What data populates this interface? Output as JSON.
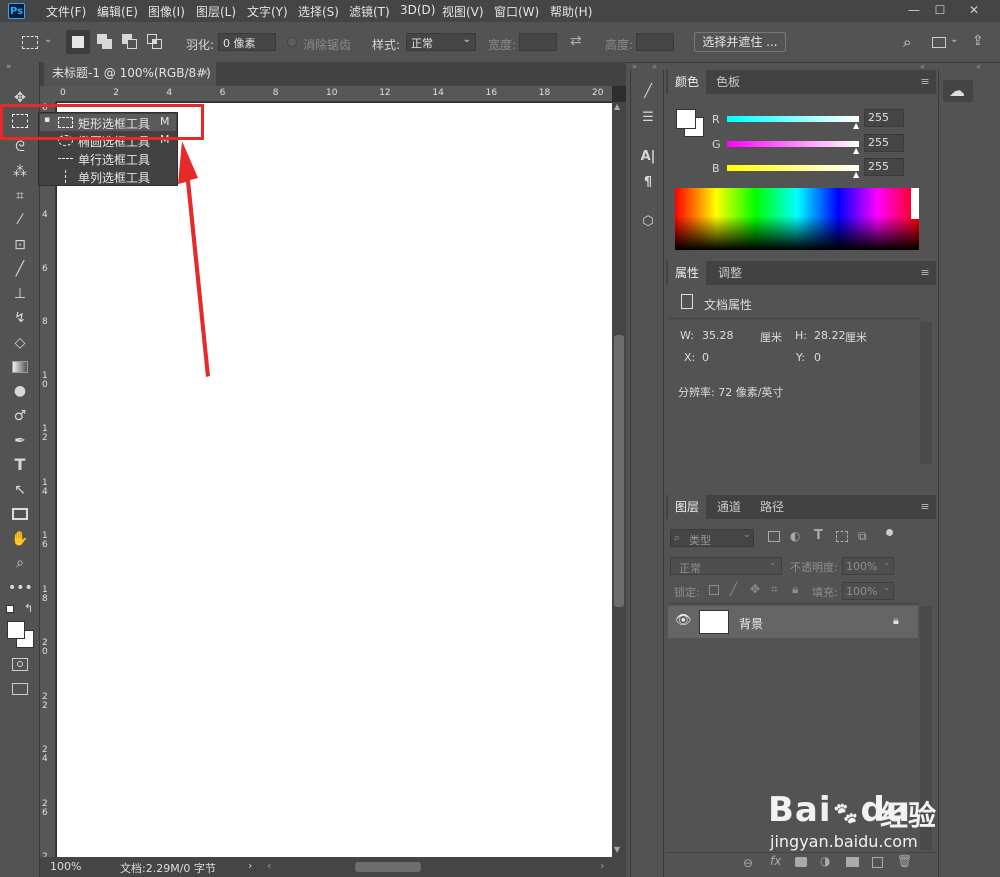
{
  "menubar": {
    "logo": "Ps",
    "items": [
      "文件(F)",
      "编辑(E)",
      "图像(I)",
      "图层(L)",
      "文字(Y)",
      "选择(S)",
      "滤镜(T)",
      "3D(D)",
      "视图(V)",
      "窗口(W)",
      "帮助(H)"
    ],
    "minimize": "—",
    "maximize": "☐",
    "close": "✕"
  },
  "options": {
    "feather_label": "羽化:",
    "feather_value": "0 像素",
    "antialias_label": "消除锯齿",
    "style_label": "样式:",
    "style_value": "正常",
    "width_label": "宽度:",
    "height_label": "高度:",
    "select_mask_button": "选择并遮住 ..."
  },
  "document": {
    "tab_title": "未标题-1 @ 100%(RGB/8#)",
    "close": "×",
    "ruler_top": [
      "0",
      "2",
      "4",
      "6",
      "8",
      "10",
      "12",
      "14",
      "16",
      "18",
      "20"
    ],
    "ruler_left": [
      "0",
      "2",
      "4",
      "6",
      "8",
      "1\n0",
      "1\n2",
      "1\n4",
      "1\n6",
      "1\n8",
      "2\n0",
      "2\n2",
      "2\n4",
      "2\n6",
      "2\n8"
    ],
    "status_zoom": "100%",
    "status_doc": "文档:2.29M/0 字节"
  },
  "flyout": {
    "items": [
      {
        "label": "矩形选框工具",
        "shortcut": "M"
      },
      {
        "label": "椭圆选框工具",
        "shortcut": "M"
      },
      {
        "label": "单行选框工具",
        "shortcut": ""
      },
      {
        "label": "单列选框工具",
        "shortcut": ""
      }
    ]
  },
  "color_panel": {
    "tab_color": "颜色",
    "tab_swatches": "色板",
    "r_label": "R",
    "g_label": "G",
    "b_label": "B",
    "r_value": "255",
    "g_value": "255",
    "b_value": "255"
  },
  "properties_panel": {
    "tab_properties": "属性",
    "tab_adjust": "调整",
    "doc_props": "文档属性",
    "w_label": "W:",
    "w_value": "35.28",
    "w_unit": "厘米",
    "h_label": "H:",
    "h_value": "28.22",
    "h_unit": "厘米",
    "x_label": "X:",
    "x_value": "0",
    "y_label": "Y:",
    "y_value": "0",
    "resolution": "分辨率: 72 像素/英寸"
  },
  "layers_panel": {
    "tab_layers": "图层",
    "tab_channels": "通道",
    "tab_paths": "路径",
    "filter_placeholder": "类型",
    "blend_mode": "正常",
    "opacity_label": "不透明度:",
    "opacity_value": "100%",
    "lock_label": "锁定:",
    "fill_label": "填充:",
    "fill_value": "100%",
    "layer_name": "背景"
  },
  "watermark": {
    "logo": "Bai",
    "logo_suffix": "du",
    "cn": "经验",
    "url": "jingyan.baidu.com"
  },
  "colors": {
    "accent_red": "#e52a2a",
    "ps_blue": "#31a8ff"
  }
}
